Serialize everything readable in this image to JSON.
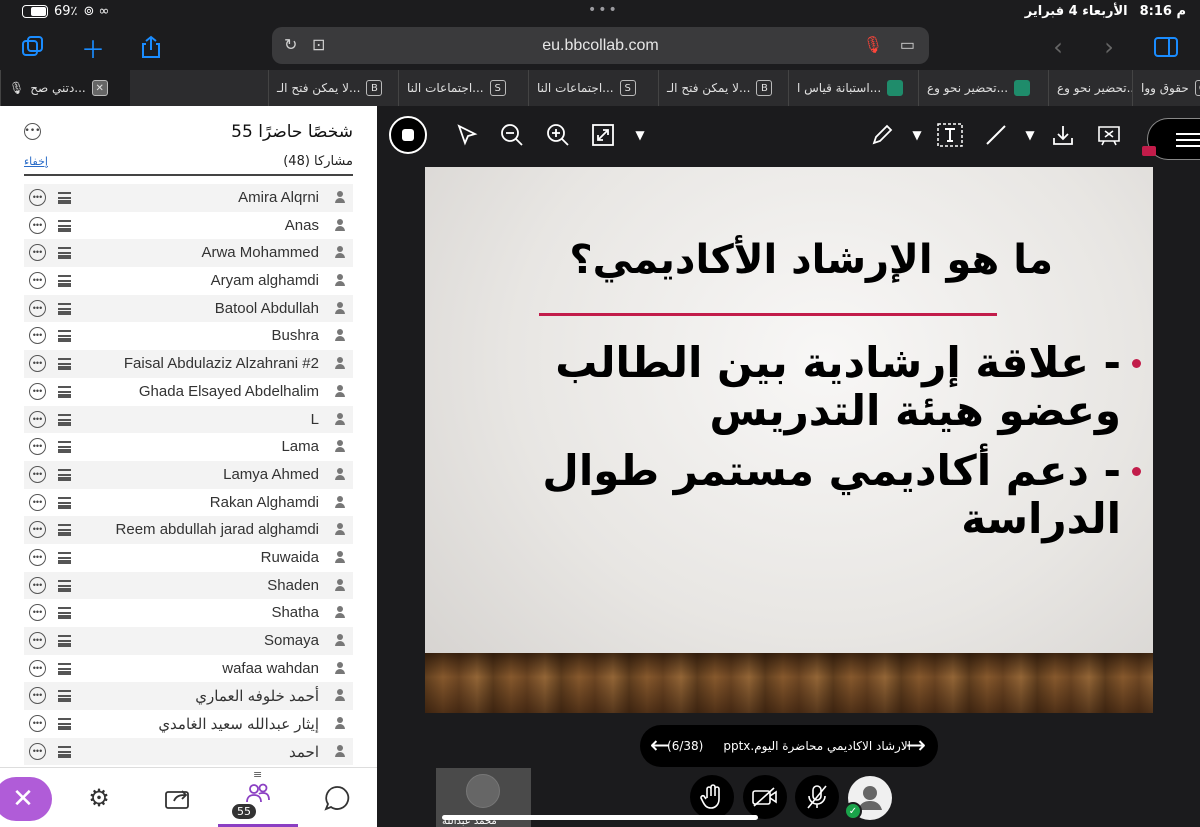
{
  "status": {
    "time": "8:16 م",
    "date": "الأربعاء 4 فبراير",
    "battery_text": "69٪",
    "battery_level": 0.69
  },
  "browser": {
    "url": "eu.bbcollab.com",
    "tabs": [
      {
        "icon": "G",
        "title": "حقوق ووا",
        "type": "letter"
      },
      {
        "icon": "",
        "title": "تحضير نحو وع...",
        "type": "ms"
      },
      {
        "icon": "",
        "title": "تحضير نحو وع...",
        "type": "ms"
      },
      {
        "icon": "",
        "title": "استبانة قياس ا...",
        "type": "ms"
      },
      {
        "icon": "B",
        "title": "لا يمكن فتح الـ...",
        "type": "letter"
      },
      {
        "icon": "S",
        "title": "اجتماعات النا...",
        "type": "letter"
      },
      {
        "icon": "S",
        "title": "اجتماعات النا...",
        "type": "letter"
      },
      {
        "icon": "B",
        "title": "لا يمكن فتح الـ...",
        "type": "letter"
      },
      {
        "icon": "",
        "title": "دتني صح...",
        "type": "active"
      }
    ]
  },
  "panel": {
    "title": "55 شخصًا حاضرًا",
    "section_label": "مشاركا (48)",
    "hide_label": "إخفاء",
    "participants": [
      "Amira Alqrni",
      "Anas",
      "Arwa Mohammed",
      "Aryam alghamdi",
      "Batool Abdullah",
      "Bushra",
      "Faisal Abdulaziz Alzahrani #2",
      "Ghada Elsayed Abdelhalim",
      "L",
      "Lama",
      "Lamya Ahmed",
      "Rakan Alghamdi",
      "Reem abdullah jarad alghamdi",
      "Ruwaida",
      "Shaden",
      "Shatha",
      "Somaya",
      "wafaa wahdan",
      "أحمد خلوفه العماري",
      "إيثار عبدالله سعيد الغامدي",
      "احمد"
    ],
    "people_count": "55"
  },
  "slide": {
    "title": "ما هو الإرشاد  الأكاديمي؟",
    "bullets": [
      "- علاقة إرشادية بين الطالب وعضو هيئة التدريس",
      "- دعم أكاديمي مستمر طوال الدراسة"
    ]
  },
  "navigator": {
    "file": "الارشاد الاكاديمي محاضرة اليوم.pptx",
    "page": "(6/38)"
  },
  "video": {
    "name": "محمد عبدالله"
  },
  "colors": {
    "accent": "#1a8cff",
    "purple": "#b05cd8",
    "rule": "#c21c4a",
    "online": "#1aa34a"
  }
}
